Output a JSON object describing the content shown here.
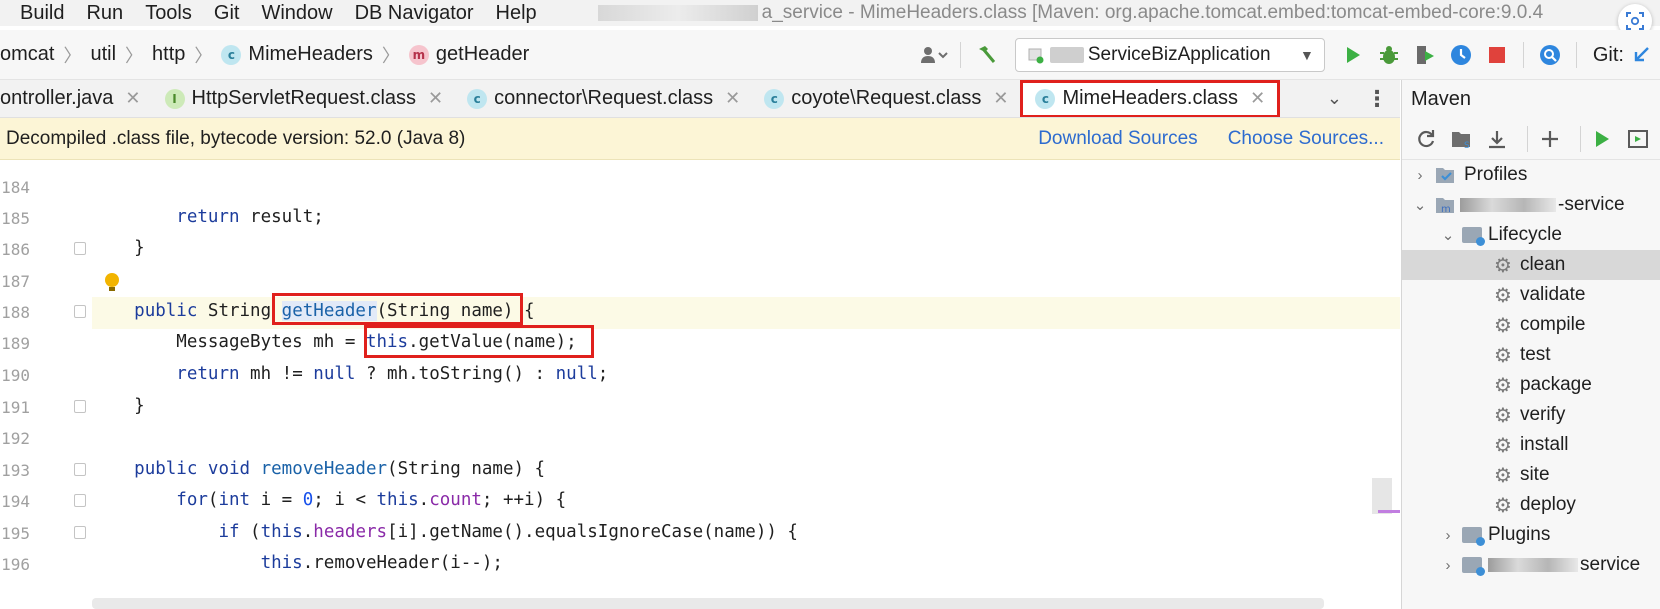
{
  "menu": {
    "items": [
      "Build",
      "Run",
      "Tools",
      "Git",
      "Window",
      "DB Navigator",
      "Help"
    ],
    "window_title": "a_service - MimeHeaders.class [Maven: org.apache.tomcat.embed:tomcat-embed-core:9.0.4"
  },
  "breadcrumb": {
    "items": [
      "omcat",
      "util",
      "http",
      "MimeHeaders",
      "getHeader"
    ]
  },
  "toolbar": {
    "run_config": "ServiceBizApplication",
    "git_label": "Git:"
  },
  "tabs": [
    {
      "label": "ontroller.java",
      "icon": "java-file-icon"
    },
    {
      "label": "HttpServletRequest.class",
      "icon": "interface-icon"
    },
    {
      "label": "connector\\Request.class",
      "icon": "class-icon"
    },
    {
      "label": "coyote\\Request.class",
      "icon": "class-icon"
    },
    {
      "label": "MimeHeaders.class",
      "icon": "class-icon",
      "active": true
    }
  ],
  "banner": {
    "text": "Decompiled .class file, bytecode version: 52.0 (Java 8)",
    "download_sources": "Download Sources",
    "choose_sources": "Choose Sources..."
  },
  "editor": {
    "line_numbers": [
      "184",
      "185",
      "186",
      "187",
      "188",
      "189",
      "190",
      "191",
      "192",
      "193",
      "194",
      "195",
      "196"
    ],
    "lines": [
      "",
      "        return result;",
      "    }",
      "",
      "    public String getHeader(String name) {",
      "        MessageBytes mh = this.getValue(name);",
      "        return mh != null ? mh.toString() : null;",
      "    }",
      "",
      "    public void removeHeader(String name) {",
      "        for(int i = 0; i < this.count; ++i) {",
      "            if (this.headers[i].getName().equalsIgnoreCase(name)) {",
      "                this.removeHeader(i--);"
    ]
  },
  "maven": {
    "title": "Maven",
    "tree": [
      {
        "label": "Profiles"
      },
      {
        "label": "-service"
      },
      {
        "label": "Lifecycle"
      },
      {
        "label": "clean",
        "selected": true
      },
      {
        "label": "validate"
      },
      {
        "label": "compile"
      },
      {
        "label": "test"
      },
      {
        "label": "package"
      },
      {
        "label": "verify"
      },
      {
        "label": "install"
      },
      {
        "label": "site"
      },
      {
        "label": "deploy"
      },
      {
        "label": "Plugins"
      },
      {
        "label": "service"
      }
    ]
  },
  "colors": {
    "highlight_box": "#e0201c",
    "banner_bg": "#fcf5d6",
    "link": "#2d6bcf",
    "keyword": "#1c3c9c"
  }
}
